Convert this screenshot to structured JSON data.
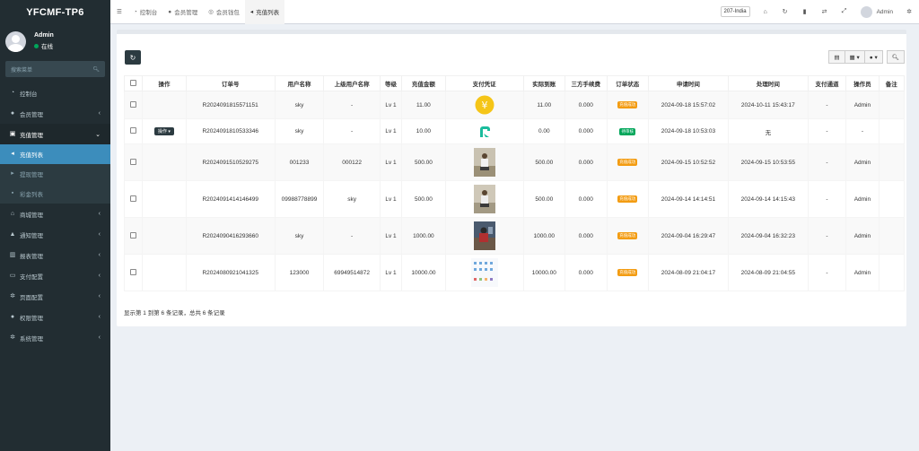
{
  "app": {
    "title": "YFCMF-TP6"
  },
  "user": {
    "name": "Admin",
    "status": "在线"
  },
  "sidebar": {
    "search_placeholder": "搜索菜单",
    "items": [
      {
        "label": "控制台",
        "icon": "dashboard-icon"
      },
      {
        "label": "会员管理",
        "icon": "user-icon"
      },
      {
        "label": "充值管理",
        "icon": "money-icon"
      },
      {
        "label": "充值列表",
        "icon": "list-icon"
      },
      {
        "label": "提现管理",
        "icon": "withdraw-icon"
      },
      {
        "label": "彩金列表",
        "icon": "gift-icon"
      },
      {
        "label": "商城管理",
        "icon": "shop-icon"
      },
      {
        "label": "通知管理",
        "icon": "bell-icon"
      },
      {
        "label": "报表管理",
        "icon": "chart-icon"
      },
      {
        "label": "支付配置",
        "icon": "card-icon"
      },
      {
        "label": "页面配置",
        "icon": "gear-icon"
      },
      {
        "label": "权限管理",
        "icon": "users-icon"
      },
      {
        "label": "系统管理",
        "icon": "cogs-icon"
      }
    ]
  },
  "topbar": {
    "tabs": [
      {
        "label": "控制台"
      },
      {
        "label": "会员管理"
      },
      {
        "label": "会员钱包"
      },
      {
        "label": "充值列表"
      }
    ],
    "lang": "207-India",
    "user": "Admin"
  },
  "table": {
    "headers": [
      "操作",
      "订单号",
      "用户名称",
      "上级用户名称",
      "等级",
      "充值金额",
      "支付凭证",
      "实际到账",
      "三方手续费",
      "订单状态",
      "申请时间",
      "处理时间",
      "支付通道",
      "操作员",
      "备注"
    ],
    "op_label": "操作",
    "rows": [
      {
        "order": "R2024091815571151",
        "user": "sky",
        "parent": "-",
        "level": "Lv 1",
        "amount": "11.00",
        "actual": "11.00",
        "fee": "0.000",
        "status": "充值成功",
        "apply": "2024-09-18 15:57:02",
        "process": "2024-10-11 15:43:17",
        "channel": "-",
        "operator": "Admin",
        "remark": ""
      },
      {
        "order": "R2024091810533346",
        "user": "sky",
        "parent": "-",
        "level": "Lv 1",
        "amount": "10.00",
        "actual": "0.00",
        "fee": "0.000",
        "status": "待审核",
        "apply": "2024-09-18 10:53:03",
        "process": "无",
        "channel": "-",
        "operator": "-",
        "remark": ""
      },
      {
        "order": "R2024091510529275",
        "user": "001233",
        "parent": "000122",
        "level": "Lv 1",
        "amount": "500.00",
        "actual": "500.00",
        "fee": "0.000",
        "status": "充值成功",
        "apply": "2024-09-15 10:52:52",
        "process": "2024-09-15 10:53:55",
        "channel": "-",
        "operator": "Admin",
        "remark": ""
      },
      {
        "order": "R2024091414146499",
        "user": "09988778899",
        "parent": "sky",
        "level": "Lv 1",
        "amount": "500.00",
        "actual": "500.00",
        "fee": "0.000",
        "status": "充值成功",
        "apply": "2024-09-14 14:14:51",
        "process": "2024-09-14 14:15:43",
        "channel": "-",
        "operator": "Admin",
        "remark": ""
      },
      {
        "order": "R2024090416293660",
        "user": "sky",
        "parent": "-",
        "level": "Lv 1",
        "amount": "1000.00",
        "actual": "1000.00",
        "fee": "0.000",
        "status": "充值成功",
        "apply": "2024-09-04 16:29:47",
        "process": "2024-09-04 16:32:23",
        "channel": "-",
        "operator": "Admin",
        "remark": ""
      },
      {
        "order": "R2024080921041325",
        "user": "123000",
        "parent": "69949514872",
        "level": "Lv 1",
        "amount": "10000.00",
        "actual": "10000.00",
        "fee": "0.000",
        "status": "充值成功",
        "apply": "2024-08-09 21:04:17",
        "process": "2024-08-09 21:04:55",
        "channel": "-",
        "operator": "Admin",
        "remark": ""
      }
    ]
  },
  "footer": {
    "summary": "显示第 1 到第 6 条记录，总共 6 条记录"
  },
  "colors": {
    "sidebar": "#222d32",
    "active": "#3c8dbc",
    "success": "#f39c12",
    "pending": "#00a65a"
  }
}
